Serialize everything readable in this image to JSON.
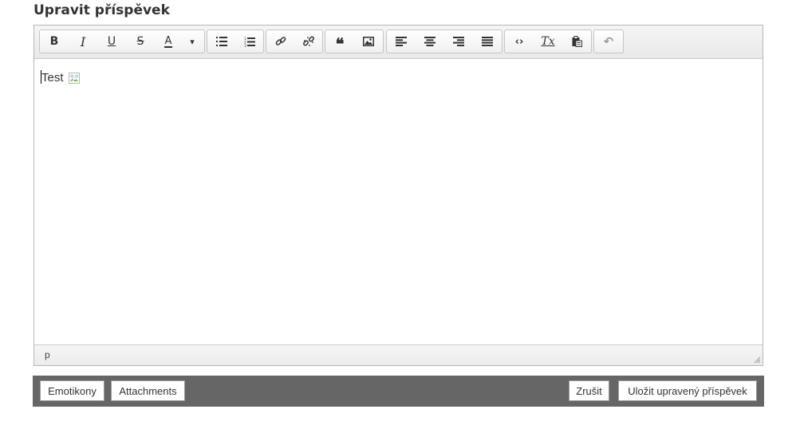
{
  "page": {
    "title": "Upravit příspěvek"
  },
  "toolbar": {
    "icons": {
      "bold": "B",
      "italic": "I",
      "underline": "U",
      "strikethrough": "S",
      "text_color": "A",
      "dropdown": "▾",
      "unordered_list": "bullet-list-icon",
      "ordered_list": "numbered-list-icon",
      "link": "link-icon",
      "unlink": "unlink-icon",
      "blockquote": "❝",
      "image": "image-icon",
      "align_left": "align-left-icon",
      "align_center": "align-center-icon",
      "align_right": "align-right-icon",
      "align_justify": "align-justify-icon",
      "source_code": "‹›",
      "clear_format": "Tx",
      "paste": "paste-icon",
      "undo": "↶"
    }
  },
  "content": {
    "text": "Test"
  },
  "statusbar": {
    "path": "p"
  },
  "actions": {
    "emoticons": "Emotikony",
    "attachments": "Attachments",
    "cancel": "Zrušit",
    "save": "Uložit upravený příspěvek"
  }
}
